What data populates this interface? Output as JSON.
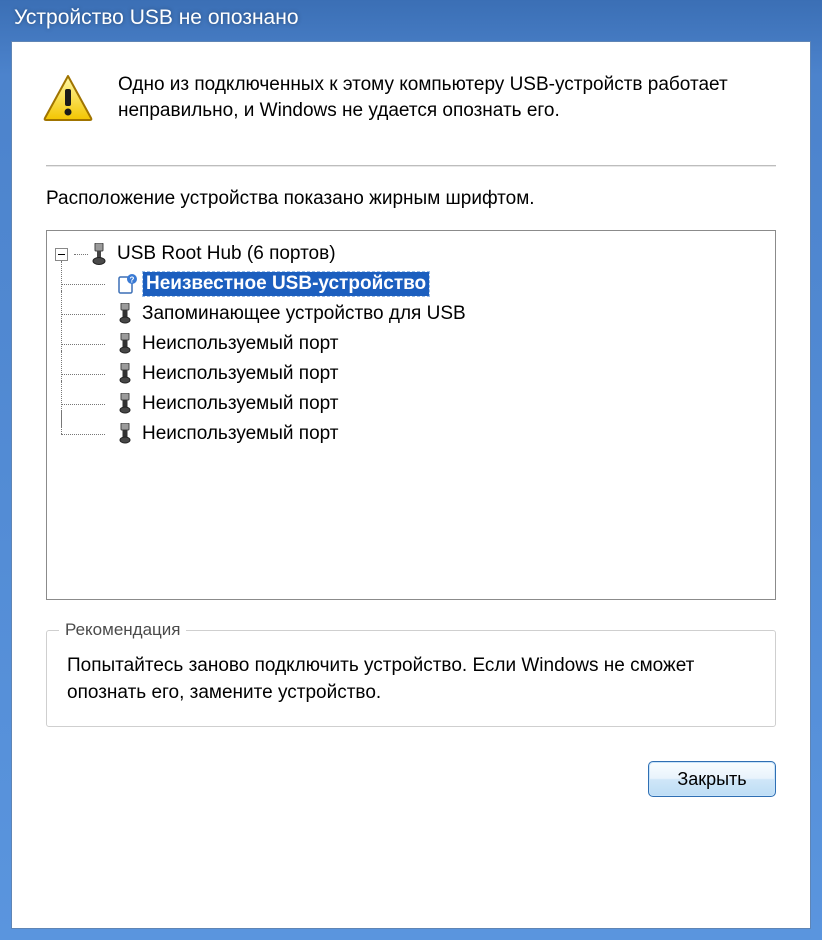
{
  "window": {
    "title": "Устройство USB не опознано"
  },
  "message": "Одно из подключенных к этому компьютеру USB-устройств работает неправильно, и Windows не удается опознать его.",
  "tree_caption": "Расположение устройства показано жирным шрифтом.",
  "tree": {
    "root": {
      "label": "USB Root Hub (6 портов)",
      "icon": "usb-hub",
      "children": [
        {
          "label": "Неизвестное USB-устройство",
          "icon": "unknown-device",
          "selected": true,
          "bold": true
        },
        {
          "label": "Запоминающее устройство для USB",
          "icon": "usb-plug"
        },
        {
          "label": "Неиспользуемый порт",
          "icon": "usb-plug"
        },
        {
          "label": "Неиспользуемый порт",
          "icon": "usb-plug"
        },
        {
          "label": "Неиспользуемый порт",
          "icon": "usb-plug"
        },
        {
          "label": "Неиспользуемый порт",
          "icon": "usb-plug"
        }
      ]
    }
  },
  "recommendation": {
    "title": "Рекомендация",
    "text": "Попытайтесь заново подключить устройство. Если Windows не сможет опознать его, замените устройство."
  },
  "buttons": {
    "close": "Закрыть"
  }
}
